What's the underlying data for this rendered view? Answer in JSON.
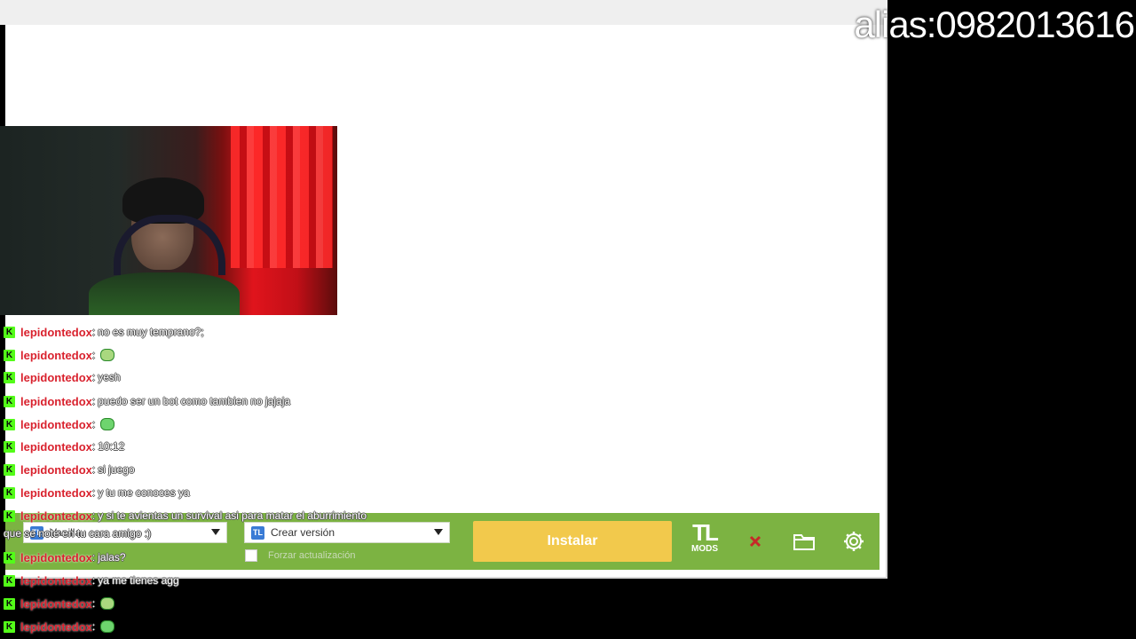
{
  "overlay": {
    "alias": "alias:0982013616"
  },
  "launcher": {
    "version_select": {
      "value": "Vanilla"
    },
    "create_version_select": {
      "value": "Crear versión"
    },
    "force_update": {
      "label": "Forzar actualización",
      "checked": false
    },
    "install_button": "Instalar",
    "logo": {
      "top": "TL",
      "bottom": "MODS"
    },
    "accent_color": "#7cb342",
    "install_color": "#f2c94c"
  },
  "chat": {
    "platform_icon": "kick-icon",
    "messages": [
      {
        "user": "lepidontedox",
        "sep": " : ",
        "text": "no es muy temprano?;",
        "emote": false
      },
      {
        "user": "lepidontedox",
        "sep": " : ",
        "text": "",
        "emote": true
      },
      {
        "user": "lepidontedox",
        "sep": " : ",
        "text": "yesh",
        "emote": false
      },
      {
        "user": "lepidontedox",
        "sep": " : ",
        "text": "puedo ser un bot como tambien no jajaja",
        "emote": false
      },
      {
        "user": "lepidontedox",
        "sep": " : ",
        "text": "",
        "emote": true
      },
      {
        "user": "lepidontedox",
        "sep": " : ",
        "text": "10:12",
        "emote": false
      },
      {
        "user": "lepidontedox",
        "sep": " : ",
        "text": "si juego",
        "emote": false
      },
      {
        "user": "lepidontedox",
        "sep": " : ",
        "text": "y tu me conoces ya",
        "emote": false
      },
      {
        "user": "lepidontedox",
        "sep": " : ",
        "text": "y si te avientas un survival asi para matar el aburrimiento",
        "emote": false
      },
      {
        "user": "lepidontedox",
        "sep": " : ",
        "text": "jalas?",
        "emote": false
      },
      {
        "user": "lepidontedox",
        "sep": " : ",
        "text": "ya me tienes agg",
        "emote": false
      },
      {
        "user": "lepidontedox",
        "sep": " : ",
        "text": "",
        "emote": true
      },
      {
        "user": "lepidontedox",
        "sep": " : ",
        "text": "",
        "emote": true
      }
    ],
    "wrapped_line": "que se note en tu cara amigo :)"
  }
}
